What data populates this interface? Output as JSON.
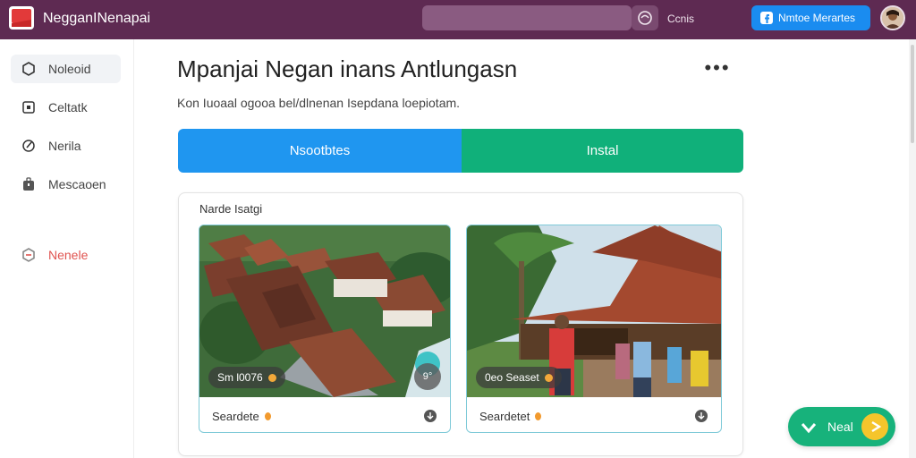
{
  "app": {
    "title": "NegganINenapai"
  },
  "header": {
    "search_placeholder": "",
    "link_label": "Ccnis",
    "primary_label": "Nmtoe Merartes"
  },
  "sidebar": {
    "items": [
      {
        "label": "Noleoid",
        "icon": "hexagon-icon",
        "active": true
      },
      {
        "label": "Celtatk",
        "icon": "square-icon"
      },
      {
        "label": "Nerila",
        "icon": "edit-icon"
      },
      {
        "label": "Mescaoen",
        "icon": "bag-icon"
      },
      {
        "label": "Nenele",
        "icon": "logout-icon",
        "danger": true
      }
    ]
  },
  "main": {
    "title": "Mpanjai Negan inans Antlungasn",
    "subtitle": "Kon Iuoaal ogooa bel/dlnenan Isepdana loepiotam.",
    "btn_blue": "Nsootbtes",
    "btn_green": "Instal",
    "more": "•••"
  },
  "panel": {
    "title": "Narde Isatgi",
    "cards": [
      {
        "badge": "Sm l0076",
        "round": "9°",
        "footer": "Seardete"
      },
      {
        "badge": "0eo Seaset",
        "footer": "Seardetet"
      }
    ]
  },
  "fab": {
    "label": "Neal"
  },
  "colors": {
    "topbar": "#5e2a52",
    "blue": "#1f96f0",
    "green": "#10b07a",
    "danger": "#e0534f"
  }
}
